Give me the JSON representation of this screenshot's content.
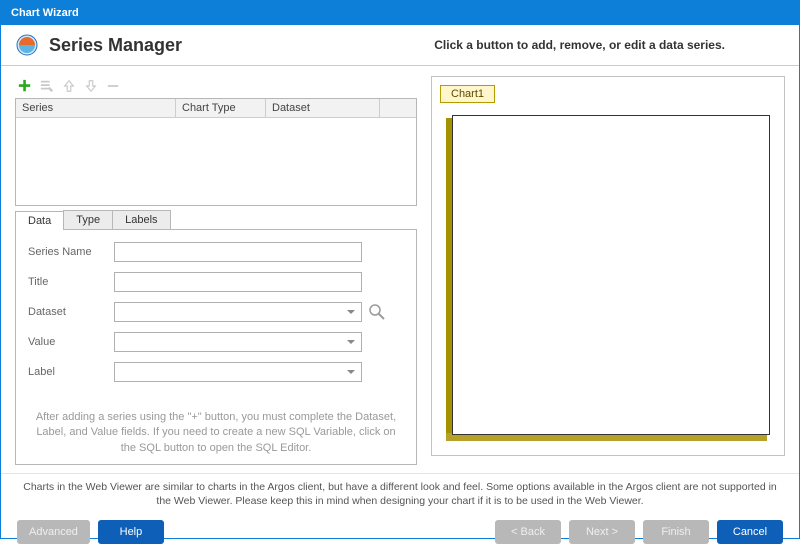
{
  "window": {
    "title": "Chart Wizard"
  },
  "header": {
    "title": "Series Manager",
    "instruction": "Click a button to add, remove, or edit a data series."
  },
  "toolbar": {
    "icons": {
      "add": "plus-icon",
      "edit": "edit-list-icon",
      "up": "arrow-up-icon",
      "down": "arrow-down-icon",
      "remove": "minus-icon"
    }
  },
  "seriesGrid": {
    "columns": [
      "Series",
      "Chart Type",
      "Dataset"
    ],
    "rows": []
  },
  "tabs": [
    "Data",
    "Type",
    "Labels"
  ],
  "activeTab": "Data",
  "form": {
    "seriesName": {
      "label": "Series Name",
      "value": ""
    },
    "title": {
      "label": "Title",
      "value": ""
    },
    "dataset": {
      "label": "Dataset",
      "value": ""
    },
    "value": {
      "label": "Value",
      "value": ""
    },
    "labelField": {
      "label": "Label",
      "value": ""
    },
    "hint": "After adding a series using the \"+\" button, you must complete the Dataset, Label, and Value fields. If you need to create a new SQL Variable, click on the SQL button to open the SQL Editor."
  },
  "chartPreview": {
    "tabLabel": "Chart1"
  },
  "footerNote": "Charts in the Web Viewer are similar to charts in the Argos client, but have a different look and feel. Some options available in the Argos client are not supported in the Web Viewer. Please keep this in mind when designing your chart if it is to be used in the Web Viewer.",
  "buttons": {
    "advanced": "Advanced",
    "help": "Help",
    "back": "< Back",
    "next": "Next >",
    "finish": "Finish",
    "cancel": "Cancel"
  },
  "chart_data": {
    "type": "area",
    "title": "Chart1",
    "series": [],
    "categories": [],
    "xlabel": "",
    "ylabel": "",
    "note": "empty-preview"
  }
}
